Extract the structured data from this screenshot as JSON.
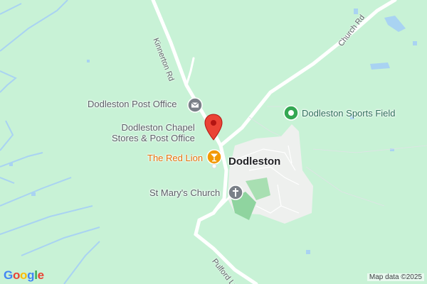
{
  "map": {
    "place_label": "Dodleston",
    "roads": {
      "kinnerton": "Kinnerton Rd",
      "church": "Church Rd",
      "pulford": "Pulford Ln"
    },
    "pois": {
      "post_office": "Dodleston Post Office",
      "chapel_line1": "Dodleston Chapel",
      "chapel_line2": "Stores & Post Office",
      "red_lion": "The Red Lion",
      "church": "St Mary's Church",
      "sports_field": "Dodleston Sports Field"
    },
    "icons": {
      "post_office": "envelope-icon",
      "chapel": "map-pin-icon",
      "red_lion": "cocktail-icon",
      "church": "cross-icon",
      "sports_field": "park-icon"
    },
    "colors": {
      "land": "#c8f2d6",
      "water": "#9cc8ee",
      "road": "#ffffff",
      "pin": "#ea4335",
      "bar": "#f29900",
      "grey_poi": "#7a8088",
      "park": "#34a853"
    }
  },
  "branding": {
    "logo_letters": [
      "G",
      "o",
      "o",
      "g",
      "l",
      "e"
    ],
    "attribution": "Map data ©2025"
  }
}
